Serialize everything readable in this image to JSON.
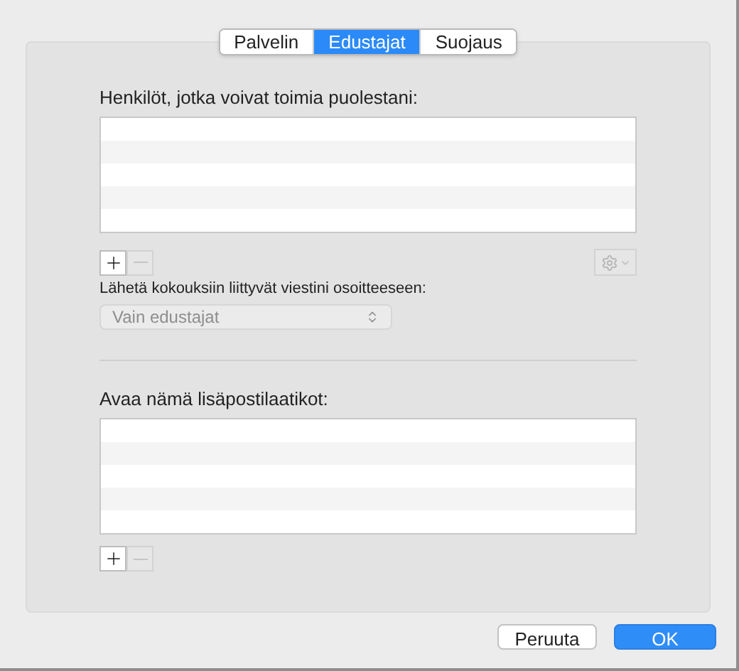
{
  "tabs": [
    {
      "label": "Palvelin",
      "selected": false
    },
    {
      "label": "Edustajat",
      "selected": true
    },
    {
      "label": "Suojaus",
      "selected": false
    }
  ],
  "delegates": {
    "label": "Henkilöt, jotka voivat toimia puolestani:",
    "controls": [
      {
        "kind": "add",
        "disabled": false
      },
      {
        "kind": "remove",
        "disabled": true
      }
    ],
    "action_menu": {
      "disabled": true
    }
  },
  "send_to": {
    "label": "Lähetä kokouksiin liittyvät viestini osoitteeseen:",
    "value": "Vain edustajat",
    "disabled": true
  },
  "mailboxes": {
    "label": "Avaa nämä lisäpostilaatikot:",
    "controls": [
      {
        "kind": "add",
        "disabled": false
      },
      {
        "kind": "remove",
        "disabled": true
      }
    ]
  },
  "buttons": [
    {
      "label": "Peruuta",
      "kind": "secondary"
    },
    {
      "label": "OK",
      "kind": "primary"
    }
  ]
}
